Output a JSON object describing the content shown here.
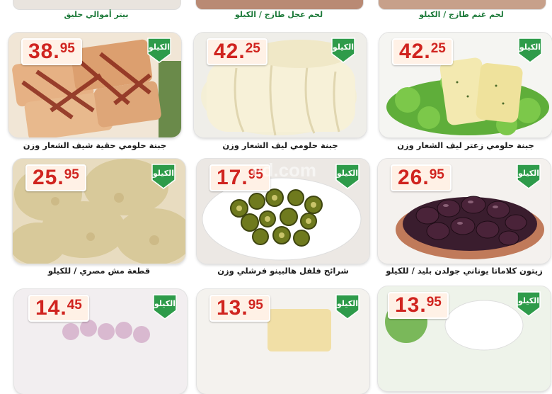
{
  "top_row": [
    {
      "label": "بيتر أموالي حليق"
    },
    {
      "label": "لحم عجل طازج / الكيلو"
    },
    {
      "label": "لحم غنم طازج / الكيلو"
    }
  ],
  "products": [
    {
      "price_main": "38.",
      "price_frac": "95",
      "unit": "الكيلو",
      "caption": "جبنة حلومي حقية شيف الشعار وزن"
    },
    {
      "price_main": "42.",
      "price_frac": "25",
      "unit": "الكيلو",
      "caption": "جبنة حلومي ليف الشعار وزن"
    },
    {
      "price_main": "42.",
      "price_frac": "25",
      "unit": "الكيلو",
      "caption": "جبنة حلومي زعتر ليف الشعار وزن"
    },
    {
      "price_main": "25.",
      "price_frac": "95",
      "unit": "الكيلو",
      "caption": "قطعة مش مصري / للكيلو"
    },
    {
      "price_main": "17.",
      "price_frac": "95",
      "unit": "الكيلو",
      "caption": "شرائح فلفل هالبينو فرشلي وزن"
    },
    {
      "price_main": "26.",
      "price_frac": "95",
      "unit": "الكيلو",
      "caption": "زيتون كلاماتا يوناني جولدن بليد / للكيلو"
    },
    {
      "price_main": "14.",
      "price_frac": "45",
      "unit": "الكيلو",
      "caption": ""
    },
    {
      "price_main": "13.",
      "price_frac": "95",
      "unit": "الكيلو",
      "caption": ""
    },
    {
      "price_main": "13.",
      "price_frac": "95",
      "unit": "الكيلو",
      "caption": ""
    }
  ],
  "watermark": "ed.com",
  "colors": {
    "price": "#d0241f",
    "badge": "#2e9b4a",
    "caption_top": "#1d7a3a"
  }
}
